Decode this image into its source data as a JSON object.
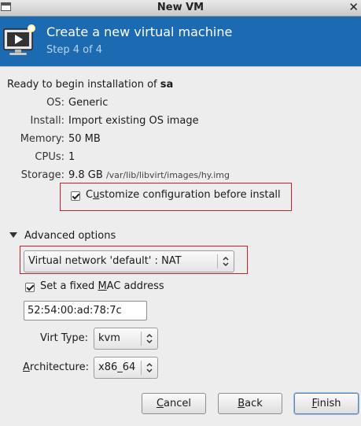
{
  "window": {
    "title": "New VM",
    "close_glyph": "✕"
  },
  "header": {
    "title": "Create a new virtual machine",
    "step": "Step 4 of 4",
    "icon": "monitor-play-icon"
  },
  "summary": {
    "ready_prefix": "Ready to begin installation of",
    "vm_name": "sa",
    "os_label": "OS:",
    "os_value": "Generic",
    "install_label": "Install:",
    "install_value": "Import existing OS image",
    "memory_label": "Memory:",
    "memory_value": "50 MB",
    "cpus_label": "CPUs:",
    "cpus_value": "1",
    "storage_label": "Storage:",
    "storage_value": "9.8 GB",
    "storage_path": "/var/lib/libvirt/images/hy.img"
  },
  "customize": {
    "pre": "C",
    "accel": "u",
    "post": "stomize configuration before install",
    "checked": true
  },
  "advanced": {
    "label": "Advanced options",
    "network": "Virtual network 'default' : NAT",
    "mac_pre": "Set a fixed ",
    "mac_accel": "M",
    "mac_post": "AC address",
    "mac_checked": true,
    "mac_value": "52:54:00:ad:78:7c",
    "virt_type_pre": "Virt Type",
    "virt_type_post": ":",
    "virt_type_value": "kvm",
    "arch_accel": "A",
    "arch_post": "rchitecture:",
    "arch_value": "x86_64"
  },
  "buttons": {
    "cancel_accel": "C",
    "cancel_post": "ancel",
    "back_accel": "B",
    "back_post": "ack",
    "finish_accel": "F",
    "finish_post": "inish"
  },
  "colors": {
    "header_bg": "#1c6ab1",
    "highlight": "#c8202a"
  }
}
